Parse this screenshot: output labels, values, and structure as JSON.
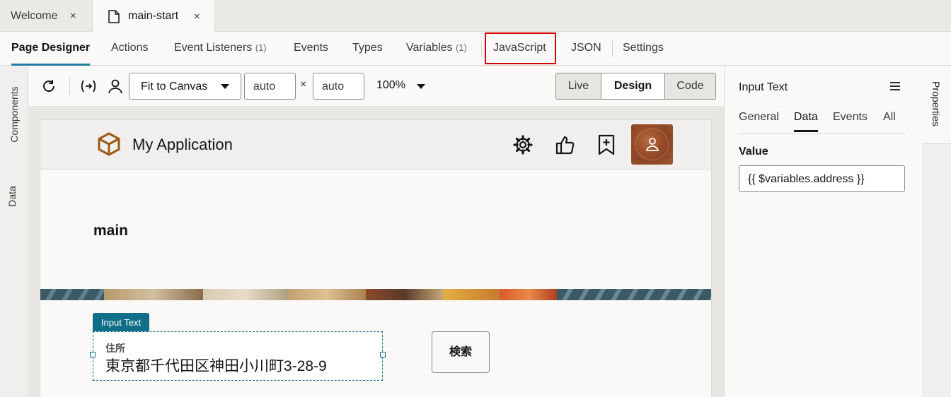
{
  "doc_tabs": [
    {
      "label": "Welcome",
      "close": "×"
    },
    {
      "label": "main-start",
      "close": "×"
    }
  ],
  "subnav": {
    "items": [
      {
        "label": "Page Designer",
        "count": ""
      },
      {
        "label": "Actions",
        "count": ""
      },
      {
        "label": "Event Listeners",
        "count": "(1)"
      },
      {
        "label": "Events",
        "count": ""
      },
      {
        "label": "Types",
        "count": ""
      },
      {
        "label": "Variables",
        "count": "(1)"
      },
      {
        "label": "JavaScript",
        "count": ""
      },
      {
        "label": "JSON",
        "count": ""
      },
      {
        "label": "Settings",
        "count": ""
      }
    ],
    "active": "Page Designer",
    "highlighted": "JavaScript"
  },
  "left_rail": {
    "components": "Components",
    "data": "Data"
  },
  "toolbar": {
    "fit_select": "Fit to Canvas",
    "width": "auto",
    "times": "×",
    "height": "auto",
    "zoom": "100%",
    "modes": [
      "Live",
      "Design",
      "Code"
    ],
    "active_mode": "Design"
  },
  "app": {
    "title": "My Application",
    "page_heading": "main",
    "badge": "Input Text",
    "field_label": "住所",
    "field_value": "東京都千代田区神田小川町3-28-9",
    "search_button": "検索"
  },
  "properties": {
    "title": "Input Text",
    "tabs": [
      "General",
      "Data",
      "Events",
      "All"
    ],
    "active_tab": "Data",
    "value_label": "Value",
    "value": "{{ $variables.address }}",
    "rail_label": "Properties"
  },
  "colors": {
    "accent": "#227e9e",
    "badge": "#0f6f86",
    "highlight_box": "#d80000",
    "logo": "#9c5a1a"
  }
}
